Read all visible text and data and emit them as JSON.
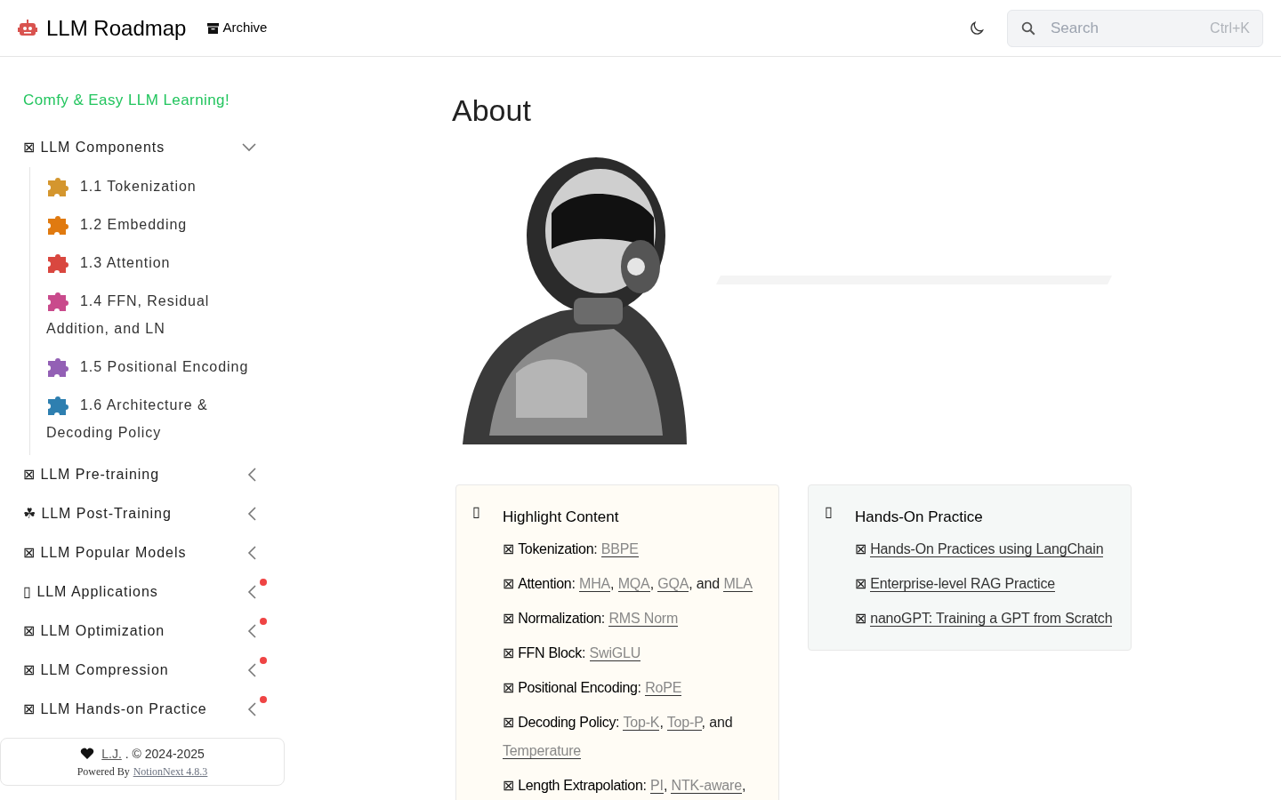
{
  "header": {
    "logo_text": "LLM Roadmap",
    "nav": [
      {
        "label": "Archive"
      }
    ],
    "search": {
      "placeholder": "Search",
      "shortcut": "Ctrl+K"
    }
  },
  "sidebar": {
    "tagline": "Comfy & Easy LLM Learning!",
    "items": [
      {
        "icon": "⊠",
        "label": "LLM Components",
        "expanded": true,
        "badge": false,
        "children": [
          {
            "label": "1.1 Tokenization",
            "color": "#d4962e"
          },
          {
            "label": "1.2 Embedding",
            "color": "#e07a10"
          },
          {
            "label": "1.3 Attention",
            "color": "#d9473f"
          },
          {
            "label": "1.4 FFN, Residual Addition, and LN",
            "color": "#c94a8c"
          },
          {
            "label": "1.5 Positional Encoding",
            "color": "#9360b5"
          },
          {
            "label": "1.6 Architecture & Decoding Policy",
            "color": "#2e7fb0"
          }
        ]
      },
      {
        "icon": "⊠",
        "label": "LLM Pre-training",
        "expanded": false,
        "badge": false
      },
      {
        "icon": "☘",
        "label": "LLM Post-Training",
        "expanded": false,
        "badge": false
      },
      {
        "icon": "⊠",
        "label": "LLM Popular Models",
        "expanded": false,
        "badge": false
      },
      {
        "icon": "▯",
        "label": "LLM Applications",
        "expanded": false,
        "badge": true
      },
      {
        "icon": "⊠",
        "label": "LLM Optimization",
        "expanded": false,
        "badge": true
      },
      {
        "icon": "⊠",
        "label": "LLM Compression",
        "expanded": false,
        "badge": true
      },
      {
        "icon": "⊠",
        "label": "LLM Hands-on Practice",
        "expanded": false,
        "badge": true
      }
    ],
    "footer": {
      "author": "L.J.",
      "copyright": ". © 2024-2025",
      "powered_by": "Powered By",
      "engine": "NotionNext 4.8.3"
    }
  },
  "main": {
    "title": "About",
    "callouts": [
      {
        "icon": "▯",
        "title": "Highlight Content",
        "color": "#fffcf5",
        "items": [
          {
            "icon": "⊠",
            "label": "Tokenization",
            "parts": [
              {
                "kind": "text",
                "text": ": "
              },
              {
                "kind": "link",
                "text": "BBPE"
              }
            ]
          },
          {
            "icon": "⊠",
            "label": "Attention",
            "parts": [
              {
                "kind": "text",
                "text": ": "
              },
              {
                "kind": "link",
                "text": "MHA"
              },
              {
                "kind": "text",
                "text": ", "
              },
              {
                "kind": "link",
                "text": "MQA"
              },
              {
                "kind": "text",
                "text": ", "
              },
              {
                "kind": "link",
                "text": "GQA"
              },
              {
                "kind": "text",
                "text": ", and "
              },
              {
                "kind": "link",
                "text": "MLA"
              }
            ]
          },
          {
            "icon": "⊠",
            "label": "Normalization",
            "parts": [
              {
                "kind": "text",
                "text": ": "
              },
              {
                "kind": "link",
                "text": "RMS Norm"
              }
            ]
          },
          {
            "icon": "⊠",
            "label": "FFN Block",
            "parts": [
              {
                "kind": "text",
                "text": ": "
              },
              {
                "kind": "link",
                "text": "SwiGLU"
              }
            ]
          },
          {
            "icon": "⊠",
            "label": "Positional Encoding",
            "parts": [
              {
                "kind": "text",
                "text": ": "
              },
              {
                "kind": "link",
                "text": "RoPE"
              }
            ]
          },
          {
            "icon": "⊠",
            "label": "Decoding Policy",
            "parts": [
              {
                "kind": "text",
                "text": ": "
              },
              {
                "kind": "link",
                "text": "Top-K"
              },
              {
                "kind": "text",
                "text": ", "
              },
              {
                "kind": "link",
                "text": "Top-P"
              },
              {
                "kind": "text",
                "text": ", and "
              },
              {
                "kind": "link",
                "text": "Temperature"
              }
            ]
          },
          {
            "icon": "⊠",
            "label": "Length Extrapolation",
            "parts": [
              {
                "kind": "text",
                "text": ": "
              },
              {
                "kind": "link",
                "text": "PI"
              },
              {
                "kind": "text",
                "text": ", "
              },
              {
                "kind": "link",
                "text": "NTK-aware"
              },
              {
                "kind": "text",
                "text": ","
              }
            ]
          }
        ]
      },
      {
        "icon": "▯",
        "title": "Hands-On Practice",
        "color": "#f5f8f7",
        "items": [
          {
            "icon": "⊠",
            "parts": [
              {
                "kind": "link",
                "text": "Hands-On Practices using LangChain"
              }
            ]
          },
          {
            "icon": "⊠",
            "parts": [
              {
                "kind": "link",
                "text": "Enterprise-level RAG Practice"
              }
            ]
          },
          {
            "icon": "⊠",
            "parts": [
              {
                "kind": "link",
                "text": "nanoGPT: Training a GPT from Scratch"
              }
            ]
          }
        ]
      }
    ]
  }
}
